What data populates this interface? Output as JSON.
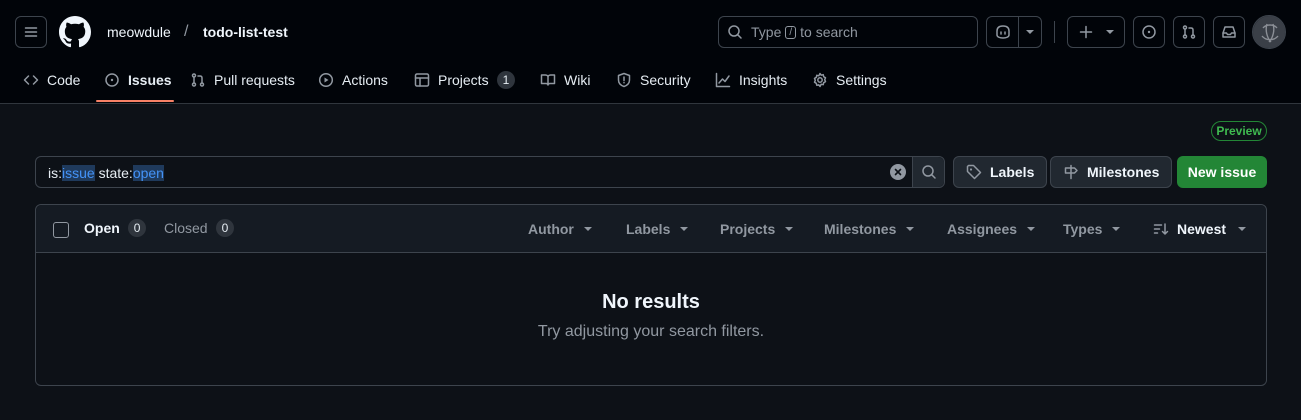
{
  "header": {
    "owner": "meowdule",
    "separator": "/",
    "repo": "todo-list-test",
    "search_prefix": "Type",
    "search_key": "/",
    "search_suffix": "to search"
  },
  "tabs": [
    {
      "label": "Code",
      "icon": "code-icon"
    },
    {
      "label": "Issues",
      "icon": "issue-opened-icon",
      "selected": true
    },
    {
      "label": "Pull requests",
      "icon": "git-pull-request-icon"
    },
    {
      "label": "Actions",
      "icon": "play-icon"
    },
    {
      "label": "Projects",
      "icon": "table-icon",
      "count": "1"
    },
    {
      "label": "Wiki",
      "icon": "book-icon"
    },
    {
      "label": "Security",
      "icon": "shield-icon"
    },
    {
      "label": "Insights",
      "icon": "graph-icon"
    },
    {
      "label": "Settings",
      "icon": "gear-icon"
    }
  ],
  "preview_badge": "Preview",
  "filter": {
    "q1_key": "is:",
    "q1_value": "issue",
    "q2_key": " state:",
    "q2_value": "open"
  },
  "buttons": {
    "labels": "Labels",
    "milestones": "Milestones",
    "new_issue": "New issue"
  },
  "list_header": {
    "open_label": "Open",
    "open_count": "0",
    "closed_label": "Closed",
    "closed_count": "0",
    "filters": [
      "Author",
      "Labels",
      "Projects",
      "Milestones",
      "Assignees",
      "Types"
    ],
    "sort_label": "Newest"
  },
  "empty_state": {
    "title": "No results",
    "message": "Try adjusting your search filters."
  },
  "colors": {
    "background": "#0d1117",
    "header_bg": "#010409",
    "accent_underline": "#f78166",
    "primary_button": "#238636",
    "query_value": "#4493f8"
  }
}
